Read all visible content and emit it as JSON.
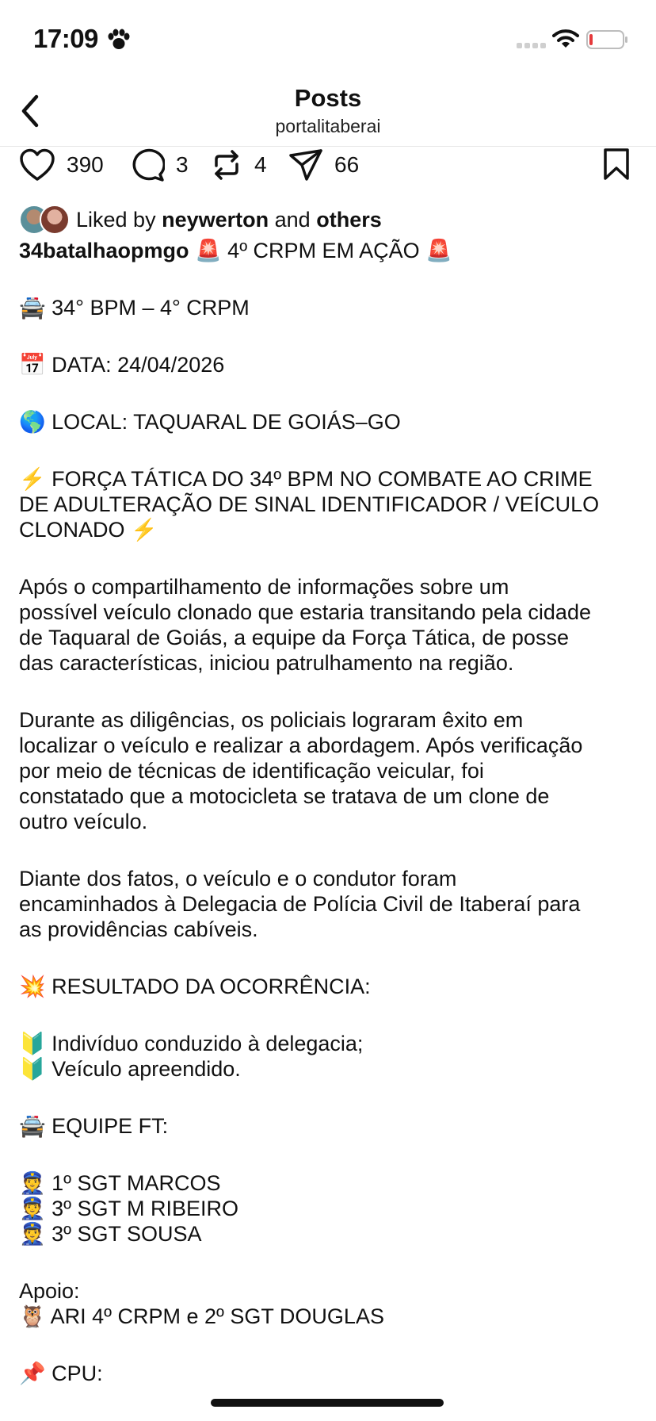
{
  "status_bar": {
    "time": "17:09"
  },
  "nav": {
    "title": "Posts",
    "subtitle": "portalitaberai"
  },
  "actions": {
    "likes": "390",
    "comments": "3",
    "reposts": "4",
    "shares": "66"
  },
  "liked_by": {
    "prefix": "Liked by",
    "user": "neywerton",
    "and": "and",
    "others": "others"
  },
  "caption": {
    "username": "34batalhaopmgo",
    "headline": "🚨 4º CRPM EM AÇÃO 🚨",
    "line_bpm": "🚔 34° BPM – 4° CRPM",
    "line_date": "📅 DATA: 24/04/2026",
    "line_local": "🌎 LOCAL: TAQUARAL DE GOIÁS–GO",
    "line_forca_1": "⚡ FORÇA TÁTICA DO 34º BPM NO COMBATE AO CRIME",
    "line_forca_2": "DE ADULTERAÇÃO DE SINAL IDENTIFICADOR / VEÍCULO",
    "line_forca_3": "CLONADO ⚡",
    "p1_1": "Após o compartilhamento de informações sobre um",
    "p1_2": "possível veículo clonado que estaria transitando pela cidade",
    "p1_3": "de Taquaral de Goiás, a equipe da Força Tática, de posse",
    "p1_4": "das características, iniciou patrulhamento na região.",
    "p2_1": "Durante as diligências, os policiais lograram êxito em",
    "p2_2": "localizar o veículo e realizar a abordagem. Após verificação",
    "p2_3": "por meio de técnicas de identificação veicular, foi",
    "p2_4": "constatado que a motocicleta se tratava de um clone de",
    "p2_5": "outro veículo.",
    "p3_1": "Diante dos fatos, o veículo e o condutor foram",
    "p3_2": "encaminhados à Delegacia de Polícia Civil de Itaberaí para",
    "p3_3": "as providências cabíveis.",
    "resultado": "💥 RESULTADO DA OCORRÊNCIA:",
    "res_1": "🔰 Indivíduo conduzido à delegacia;",
    "res_2": "🔰 Veículo apreendido.",
    "equipe": "🚔 EQUIPE FT:",
    "eq_1": "👮 1º SGT MARCOS",
    "eq_2": "👮 3º SGT M RIBEIRO",
    "eq_3": "👮 3º SGT SOUSA",
    "apoio": "Apoio:",
    "apoio_1": "🦉 ARI 4º CRPM e 2º SGT DOUGLAS",
    "cpu": "📌 CPU:"
  },
  "colors": {
    "text": "#111111",
    "battery_low": "#e5393b",
    "divider": "#e6e6e6"
  },
  "icons": [
    "paw-icon",
    "signal-icon",
    "wifi-icon",
    "battery-icon",
    "back-chevron-icon",
    "heart-icon",
    "comment-icon",
    "repost-icon",
    "share-icon",
    "bookmark-icon"
  ]
}
